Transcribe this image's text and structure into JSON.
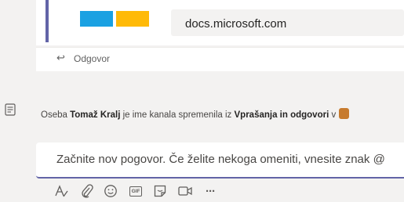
{
  "top_card": {
    "link_text": "docs.microsoft.com"
  },
  "reply": {
    "label": "Odgovor",
    "icon": "reply-arrow-icon"
  },
  "system_message": {
    "prefix": "Oseba ",
    "person": "Tomaž Kralj",
    "middle": " je ime kanala spremenila iz ",
    "channel": "Vprašanja in odgovori",
    "suffix": " v",
    "icon": "message-icon"
  },
  "compose": {
    "placeholder": "Začnite nov pogovor. Če želite nekoga omeniti, vnesite znak @"
  },
  "toolbar": {
    "gif_label": "GIF",
    "more_label": "···",
    "icons": [
      "format-icon",
      "attach-icon",
      "emoji-icon",
      "gif-icon",
      "sticker-icon",
      "meet-now-icon",
      "more-options-icon"
    ]
  },
  "colors": {
    "accent": "#6264a7",
    "logo_blue": "#1ba1e2",
    "logo_yellow": "#ffba08",
    "background": "#f3f2f1"
  }
}
